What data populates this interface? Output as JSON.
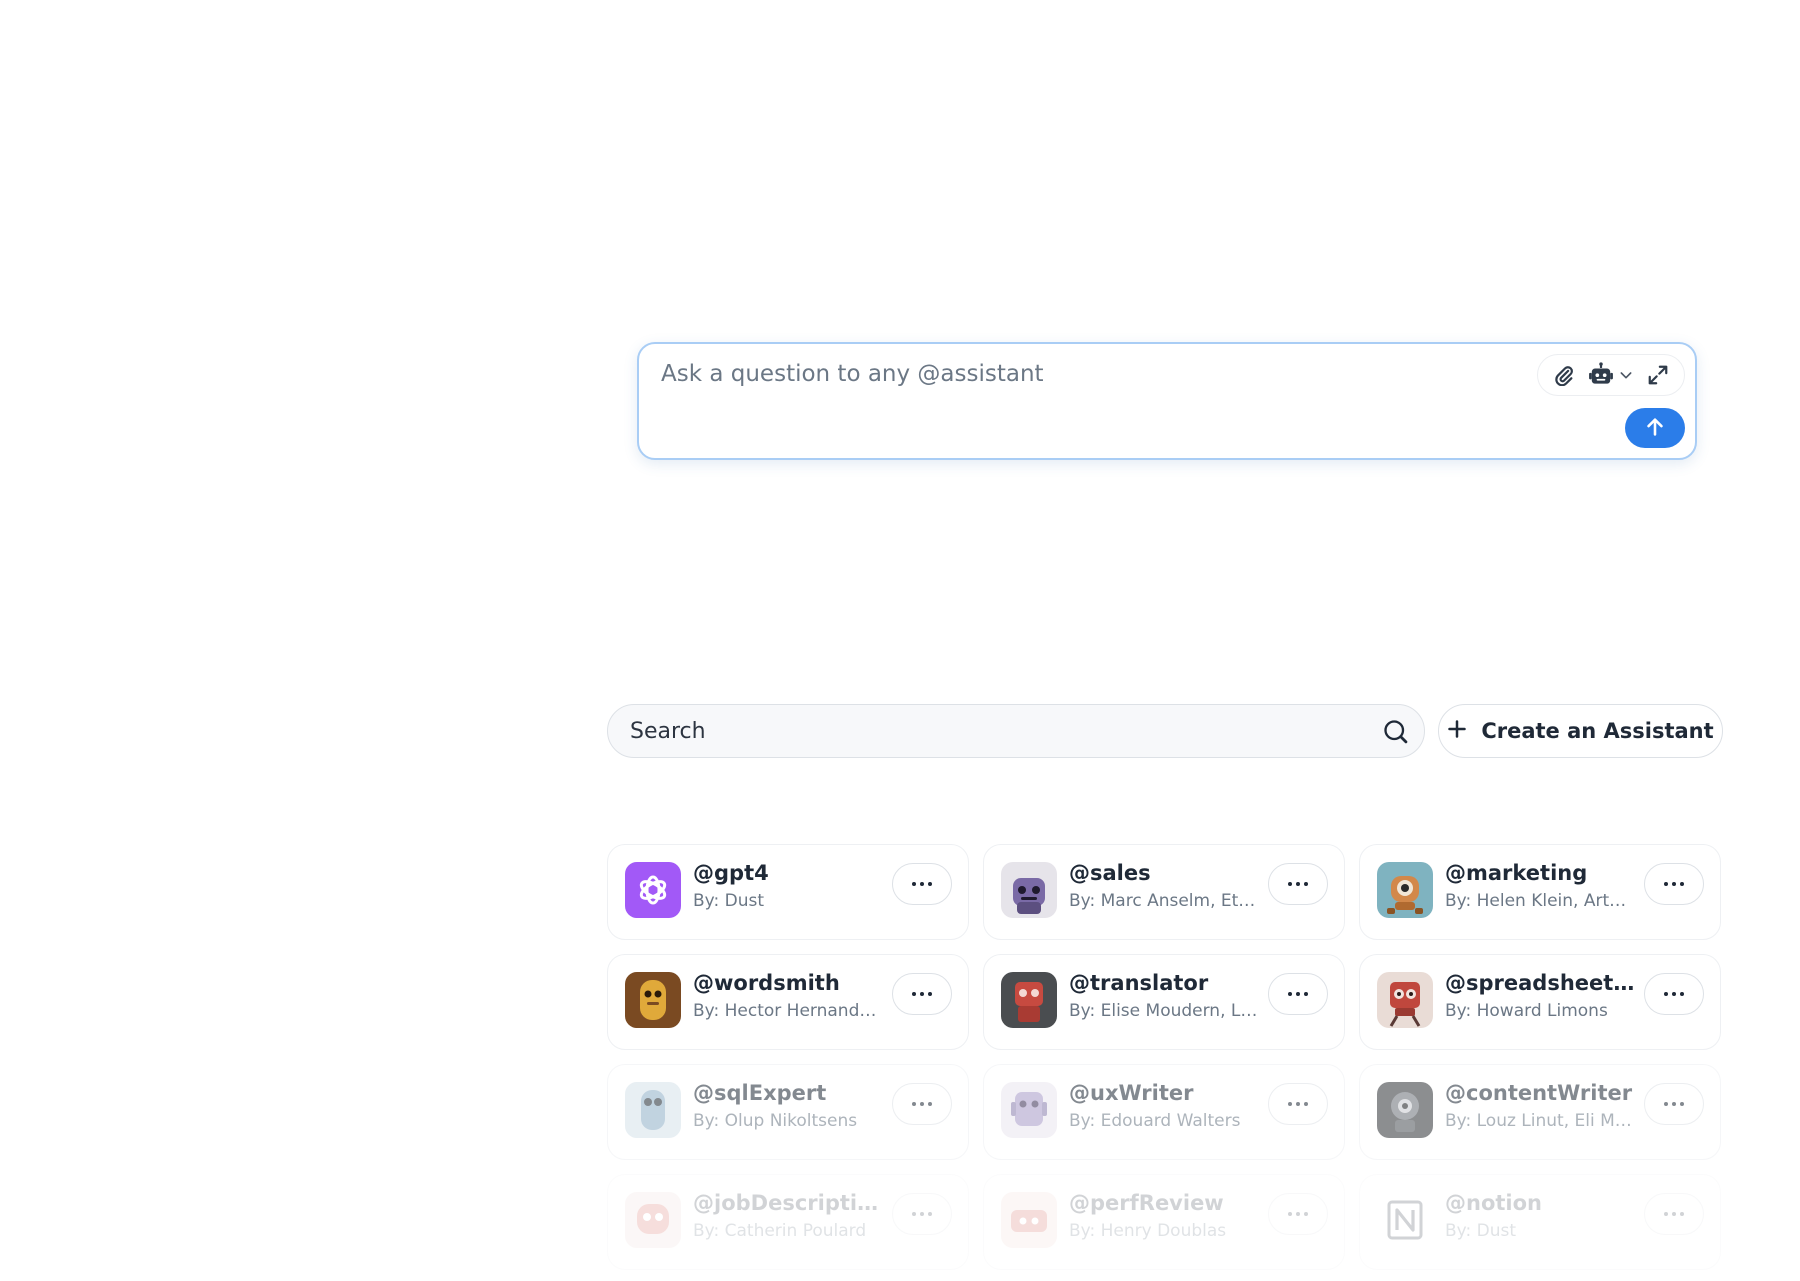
{
  "composer": {
    "placeholder": "Ask a question to any @assistant",
    "tools": [
      "paperclip-icon",
      "robot-icon",
      "chevron-down-icon",
      "expand-icon"
    ],
    "send_icon": "arrow-up-icon",
    "accent_color": "#2b7de9"
  },
  "search": {
    "placeholder": "Search",
    "icon": "search-icon"
  },
  "create_button": {
    "label": "Create an Assistant",
    "icon": "plus-icon"
  },
  "assistants": [
    {
      "name": "@gpt4",
      "author": "By: Dust",
      "avatar": "openai-logo",
      "avatar_color": "#a259f7"
    },
    {
      "name": "@sales",
      "author": "By: Marc Anselm, Et…",
      "avatar": "purple-robot",
      "avatar_color": "#7a6aa6"
    },
    {
      "name": "@marketing",
      "author": "By: Helen Klein, Art…",
      "avatar": "orange-robot",
      "avatar_color": "#d2884a"
    },
    {
      "name": "@wordsmith",
      "author": "By: Hector Hernand…",
      "avatar": "yellow-robot",
      "avatar_color": "#c8932c"
    },
    {
      "name": "@translator",
      "author": "By: Elise Moudern, L…",
      "avatar": "red-robot",
      "avatar_color": "#c74a40"
    },
    {
      "name": "@spreadsheetEx…",
      "author": "By: Howard Limons",
      "avatar": "red-robot",
      "avatar_color": "#c0473d"
    },
    {
      "name": "@sqlExpert",
      "author": "By: Olup Nikoltsens",
      "avatar": "blue-robot",
      "avatar_color": "#8fb0c8"
    },
    {
      "name": "@uxWriter",
      "author": "By: Edouard Walters",
      "avatar": "violet-robot",
      "avatar_color": "#a79bc7"
    },
    {
      "name": "@contentWriter",
      "author": "By: Louz Linut, Eli M…",
      "avatar": "gray-robot",
      "avatar_color": "#4b4f55"
    },
    {
      "name": "@jobDescription",
      "author": "By: Catherin Poulard",
      "avatar": "red-robot",
      "avatar_color": "#d46055"
    },
    {
      "name": "@perfReview",
      "author": "By: Henry Doublas",
      "avatar": "red-robot",
      "avatar_color": "#d25a50"
    },
    {
      "name": "@notion",
      "author": "By: Dust",
      "avatar": "notion-logo",
      "avatar_color": "#ffffff"
    }
  ]
}
